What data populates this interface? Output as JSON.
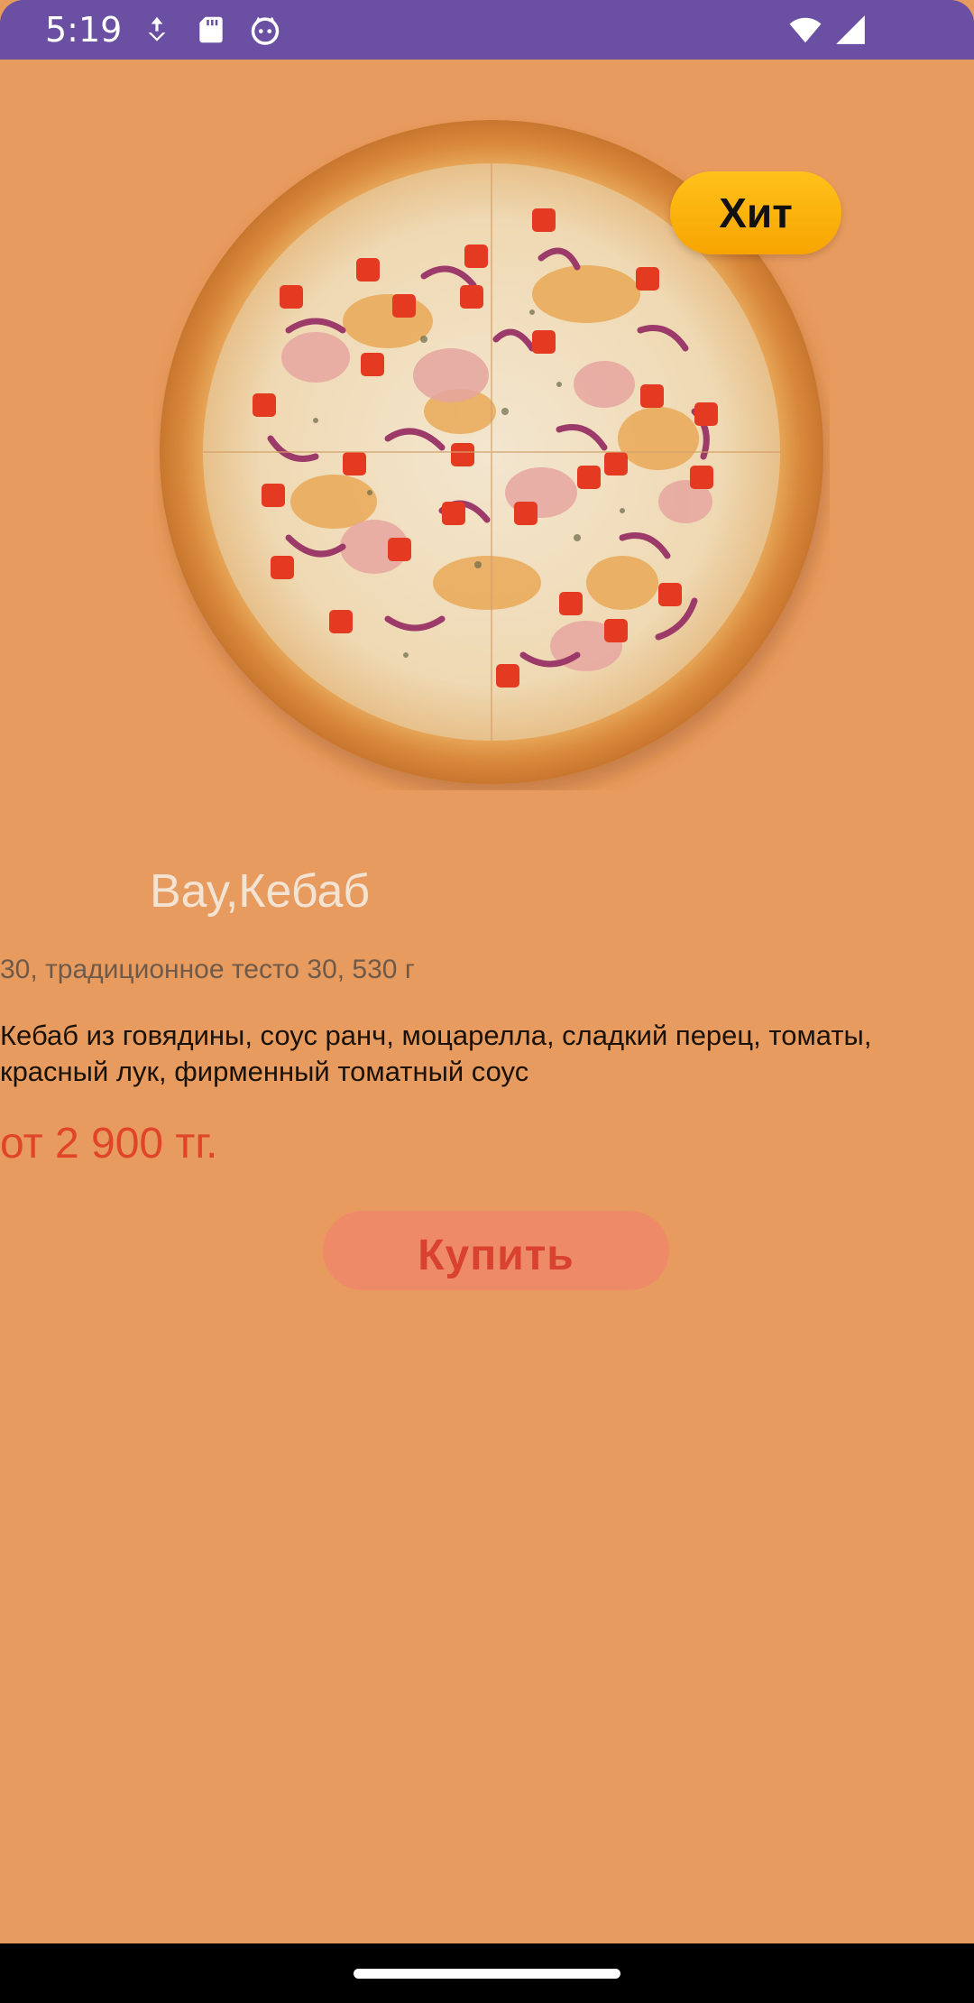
{
  "status_bar": {
    "time": "5:19",
    "left_icons": [
      "download-icon",
      "sd-card-icon",
      "face-icon"
    ],
    "right_icons": [
      "wifi-icon",
      "signal-icon"
    ],
    "background_color": "#6a4fa3"
  },
  "product": {
    "badge": "Хит",
    "name": "Вау,Кебаб",
    "details": "30, традиционное тесто 30, 530 г",
    "description": "Кебаб из говядины, соус ранч, моцарелла, сладкий перец, томаты, красный лук, фирменный томатный соус",
    "price": "от 2 900 тг.",
    "image": "pizza-image"
  },
  "actions": {
    "buy_label": "Купить"
  },
  "colors": {
    "background": "#e89b5e",
    "price": "#e0452a",
    "buy_button": "#ef8a68",
    "badge": "#ffb400"
  }
}
